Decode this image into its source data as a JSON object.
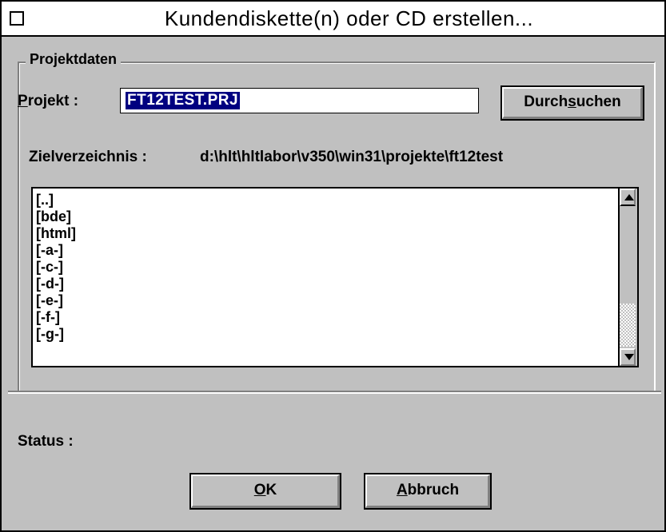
{
  "window": {
    "title": "Kundendiskette(n) oder CD erstellen..."
  },
  "group": {
    "title": "Projektdaten"
  },
  "projekt": {
    "label_accel": "P",
    "label_rest": "rojekt :",
    "value": "FT12TEST.PRJ"
  },
  "browse_button": {
    "label_pre": "Durch",
    "label_accel": "s",
    "label_post": "uchen"
  },
  "zielverzeichnis": {
    "label": "Zielverzeichnis :",
    "value": "d:\\hlt\\hltlabor\\v350\\win31\\projekte\\ft12test"
  },
  "directory_list": {
    "items": [
      "[..]",
      "[bde]",
      "[html]",
      "[-a-]",
      "[-c-]",
      "[-d-]",
      "[-e-]",
      "[-f-]",
      "[-g-]"
    ]
  },
  "status": {
    "label": "Status :"
  },
  "ok_button": {
    "label_accel": "O",
    "label_rest": "K"
  },
  "cancel_button": {
    "label_accel": "A",
    "label_rest": "bbruch"
  },
  "icons": {
    "system_menu": "system-menu-box",
    "scroll_up": "arrow-up",
    "scroll_down": "arrow-down"
  }
}
